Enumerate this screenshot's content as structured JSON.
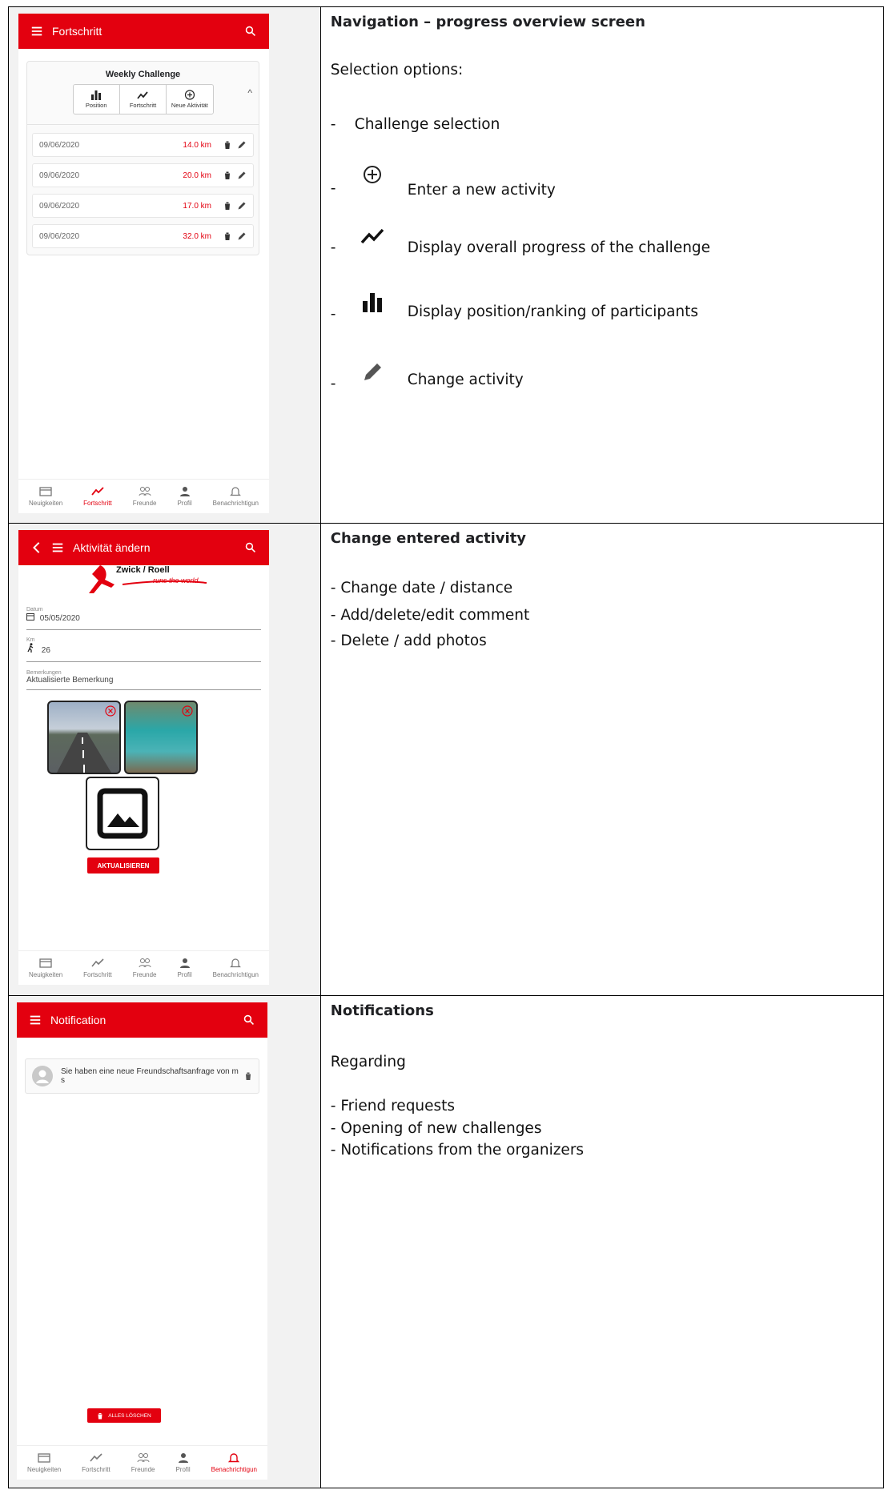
{
  "row1": {
    "phone": {
      "appbar_title": "Fortschritt",
      "card_title": "Weekly Challenge",
      "segment": [
        "Position",
        "Fortschritt",
        "Neue Aktivität"
      ],
      "entries": [
        {
          "date": "09/06/2020",
          "km": "14.0 km"
        },
        {
          "date": "09/06/2020",
          "km": "20.0 km"
        },
        {
          "date": "09/06/2020",
          "km": "17.0 km"
        },
        {
          "date": "09/06/2020",
          "km": "32.0 km"
        }
      ]
    },
    "title": "Navigation – progress overview screen",
    "subtitle": "Selection options:",
    "items": [
      "Challenge selection",
      "Enter a new activity",
      "Display overall progress of the challenge",
      "Display position/ranking of participants",
      "Change activity"
    ]
  },
  "row2": {
    "phone": {
      "appbar_title": "Aktivität ändern",
      "logo_text": "Zwick / Roell",
      "logo_sub": "runs the world",
      "date_label": "Datum",
      "date_value": "05/05/2020",
      "km_label": "Km",
      "km_value": "26",
      "remarks_label": "Bemerkungen",
      "remarks_value": "Aktualisierte Bemerkung",
      "button": "AKTUALISIEREN"
    },
    "title": "Change entered activity",
    "items": [
      "- Change date / distance",
      "- Add/delete/edit comment",
      "- Delete / add photos"
    ]
  },
  "row3": {
    "phone": {
      "appbar_title": "Notification",
      "notification": "Sie haben eine neue Freundschaftsanfrage von m s",
      "button": "ALLES LÖSCHEN"
    },
    "title": "Notifications",
    "subtitle": "Regarding",
    "items": [
      "- Friend requests",
      "- Opening of new challenges",
      "- Notifications from the organizers"
    ]
  },
  "nav": [
    "Neuigkeiten",
    "Fortschritt",
    "Freunde",
    "Profil",
    "Benachrichtigun"
  ],
  "colors": {
    "accent": "#e3000f"
  }
}
